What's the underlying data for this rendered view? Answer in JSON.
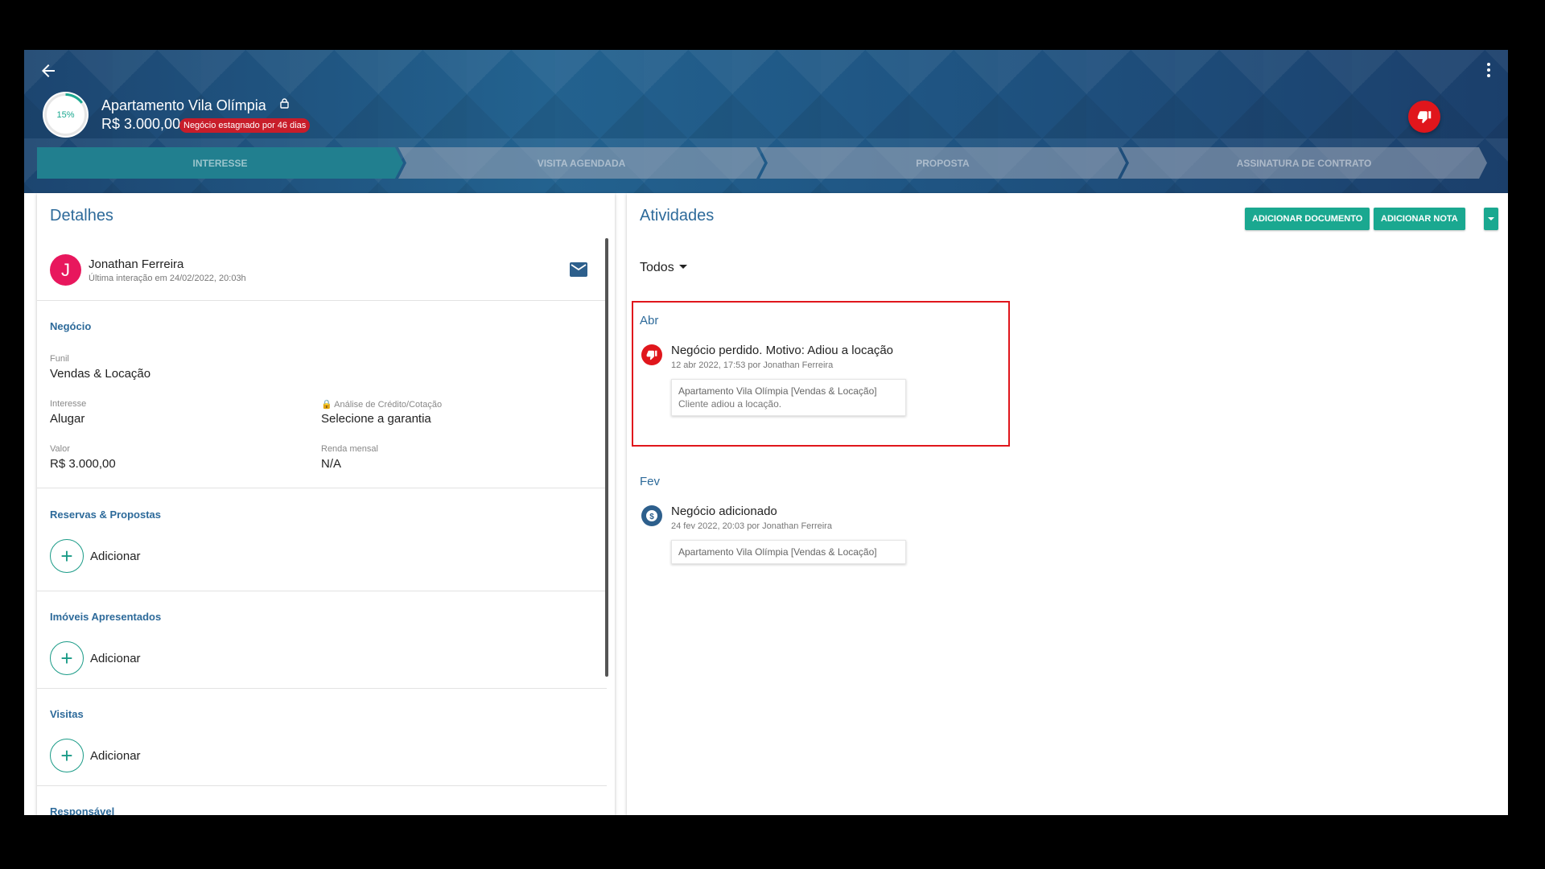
{
  "header": {
    "title": "Apartamento Vila Olímpia",
    "value": "R$ 3.000,00",
    "stagnant_badge": "Negócio estagnado por 46 dias",
    "progress_label": "15%",
    "progress_value": 0.15
  },
  "pipeline": {
    "stages": [
      {
        "label": "INTERESSE",
        "active": true
      },
      {
        "label": "VISITA AGENDADA",
        "active": false
      },
      {
        "label": "PROPOSTA",
        "active": false
      },
      {
        "label": "ASSINATURA DE CONTRATO",
        "active": false
      }
    ]
  },
  "details": {
    "heading": "Detalhes",
    "contact": {
      "initial": "J",
      "name": "Jonathan Ferreira",
      "last_interaction": "Última interação em 24/02/2022, 20:03h"
    },
    "business": {
      "title": "Negócio",
      "funnel_label": "Funil",
      "funnel_value": "Vendas & Locação",
      "interest_label": "Interesse",
      "interest_value": "Alugar",
      "credit_label": "Análise de Crédito/Cotação",
      "credit_value": "Selecione a garantia",
      "value_label": "Valor",
      "value_value": "R$ 3.000,00",
      "income_label": "Renda mensal",
      "income_value": "N/A"
    },
    "reservations": {
      "title": "Reservas & Propostas",
      "add_label": "Adicionar"
    },
    "properties": {
      "title": "Imóveis Apresentados",
      "add_label": "Adicionar"
    },
    "visits": {
      "title": "Visitas",
      "add_label": "Adicionar"
    },
    "responsible": {
      "title": "Responsável"
    }
  },
  "activities": {
    "heading": "Atividades",
    "add_document_label": "ADICIONAR DOCUMENTO",
    "add_note_label": "ADICIONAR NOTA",
    "filter_label": "Todos",
    "groups": [
      {
        "month": "Abr",
        "title": "Negócio perdido. Motivo: Adiou a locação",
        "meta": "12 abr 2022, 17:53 por Jonathan Ferreira",
        "card_title": "Apartamento Vila Olímpia [Vendas & Locação]",
        "card_body": "Cliente adiou a locação.",
        "icon": "thumbs-down-icon",
        "icon_color": "#e0161c"
      },
      {
        "month": "Fev",
        "title": "Negócio adicionado",
        "meta": "24 fev 2022, 20:03 por Jonathan Ferreira",
        "card_title": "Apartamento Vila Olímpia [Vendas & Locação]",
        "icon": "dollar-icon",
        "icon_color": "#2d5f8c"
      }
    ]
  },
  "colors": {
    "accent_teal": "#1aa890",
    "danger_red": "#e0161c",
    "heading_blue": "#2d6a9a"
  }
}
